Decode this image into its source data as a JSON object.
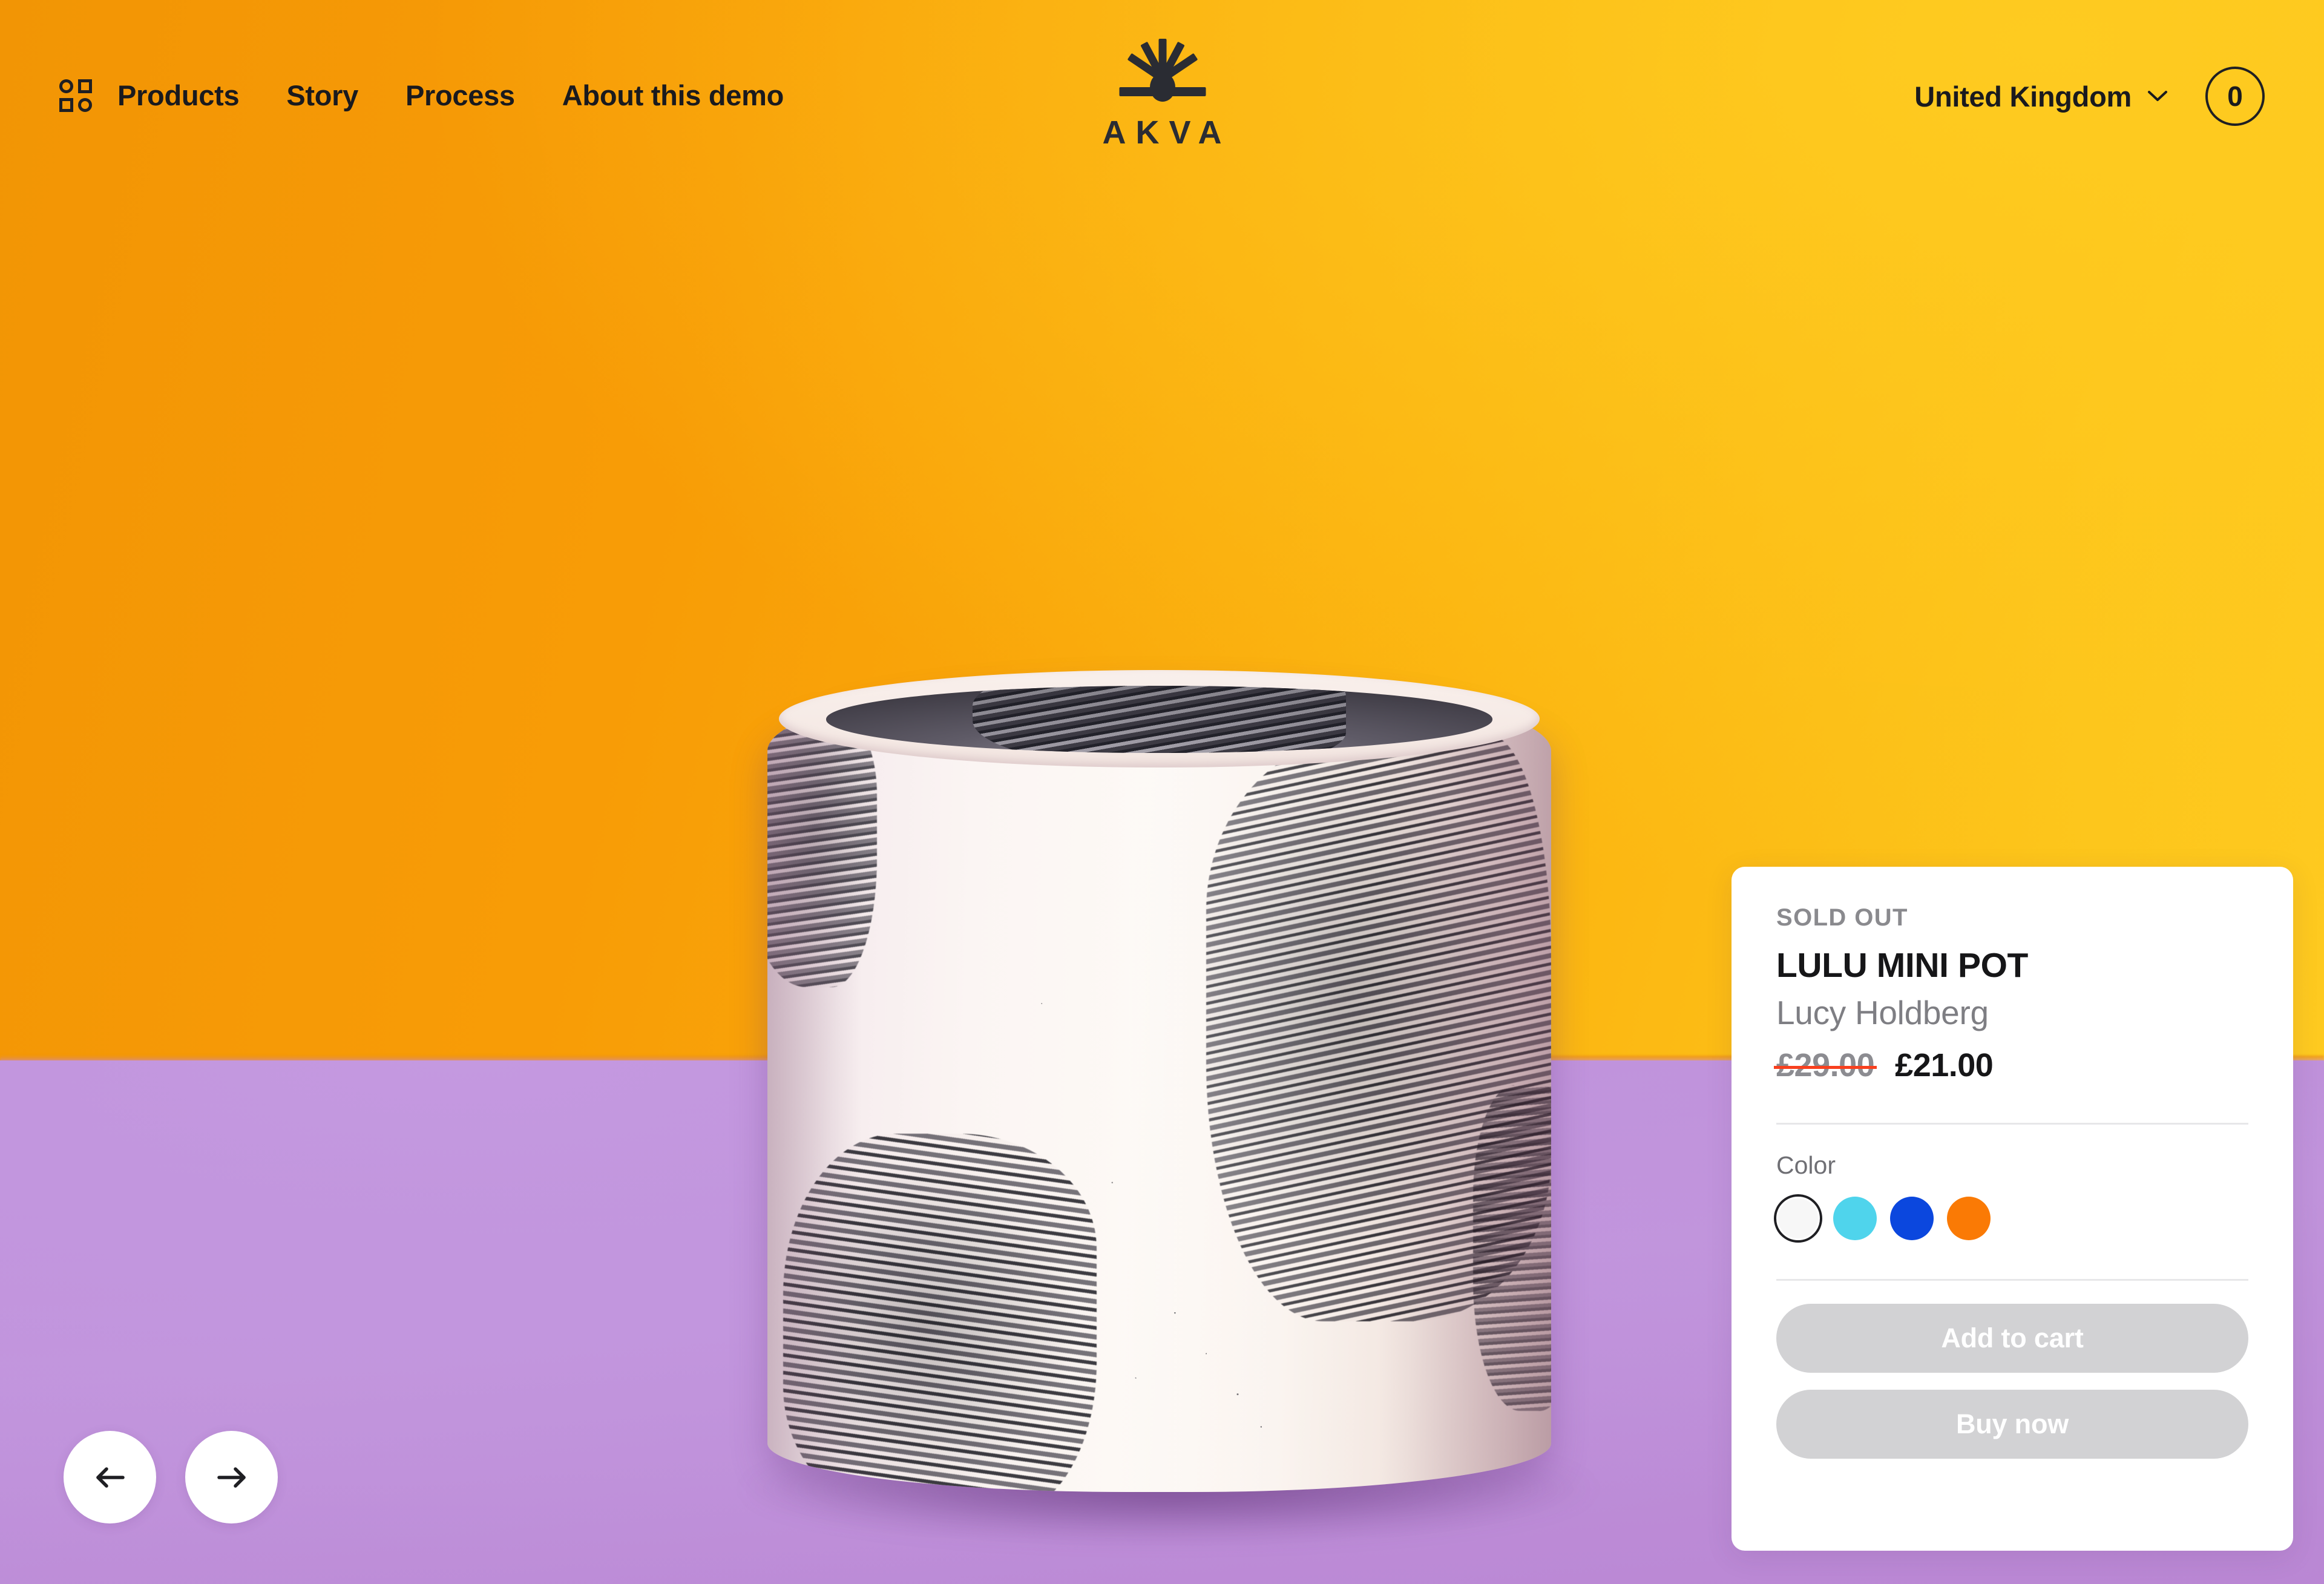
{
  "header": {
    "menu_icon": "grid-icon",
    "nav_links": [
      {
        "label": "Products"
      },
      {
        "label": "Story"
      },
      {
        "label": "Process"
      },
      {
        "label": "About this demo"
      }
    ],
    "logo": {
      "wordmark": "AKVA",
      "mark_icon": "sunburst-icon"
    },
    "region_selector": {
      "label": "United Kingdom",
      "chevron_icon": "chevron-down-icon"
    },
    "cart": {
      "count": "0",
      "icon": "cart-count-circle"
    }
  },
  "carousel": {
    "prev_icon": "arrow-left-icon",
    "next_icon": "arrow-right-icon"
  },
  "product_card": {
    "availability_badge": "SOLD OUT",
    "title": "LULU MINI POT",
    "artist": "Lucy Holdberg",
    "price_original": "£29.00",
    "price_current": "£21.00",
    "color_section_label": "Color",
    "colors": [
      {
        "name": "white",
        "hex": "#F7F7F7",
        "selected": true
      },
      {
        "name": "turquoise",
        "hex": "#4FD4EC",
        "selected": false
      },
      {
        "name": "blue",
        "hex": "#0B47DE",
        "selected": false
      },
      {
        "name": "orange",
        "hex": "#FA7A05",
        "selected": false
      }
    ],
    "add_to_cart_label": "Add to cart",
    "buy_now_label": "Buy now",
    "buttons_disabled": true
  },
  "theme": {
    "sky_color": "#F89C06",
    "sky_highlight": "#FECB20",
    "table_color": "#BC8CD8",
    "ink_color": "#1F1F23",
    "strike_color": "#F8401E",
    "disabled_button": "#D2D2D4",
    "muted_text": "#8A8A8E"
  }
}
